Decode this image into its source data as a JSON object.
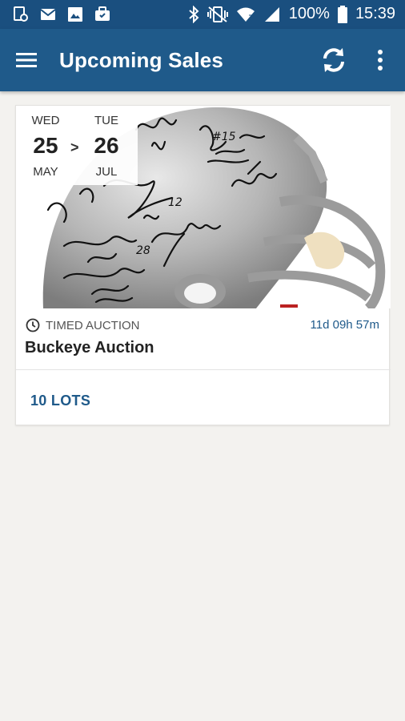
{
  "status_bar": {
    "battery": "100%",
    "time": "15:39",
    "left_icons": [
      "file-sync-icon",
      "mail-icon",
      "image-icon",
      "briefcase-icon"
    ],
    "right_icons": [
      "bluetooth-icon",
      "vibrate-mute-icon",
      "wifi-icon",
      "signal-icon",
      "battery-icon"
    ]
  },
  "app_bar": {
    "title": "Upcoming Sales",
    "icons": [
      "menu-icon",
      "refresh-icon",
      "more-vert-icon"
    ],
    "color": "#1f5a8a"
  },
  "sales": [
    {
      "start": {
        "dow": "WED",
        "day": "25",
        "month": "MAY"
      },
      "separator": ">",
      "end": {
        "dow": "TUE",
        "day": "26",
        "month": "JUL"
      },
      "type": "TIMED AUCTION",
      "countdown": "11d 09h 57m",
      "name": "Buckeye Auction",
      "lots": "10 LOTS",
      "image": "signed-football-helmet"
    }
  ],
  "colors": {
    "status_bar": "#1a4f7f",
    "accent": "#1f5a8a",
    "background": "#f3f2ef"
  }
}
